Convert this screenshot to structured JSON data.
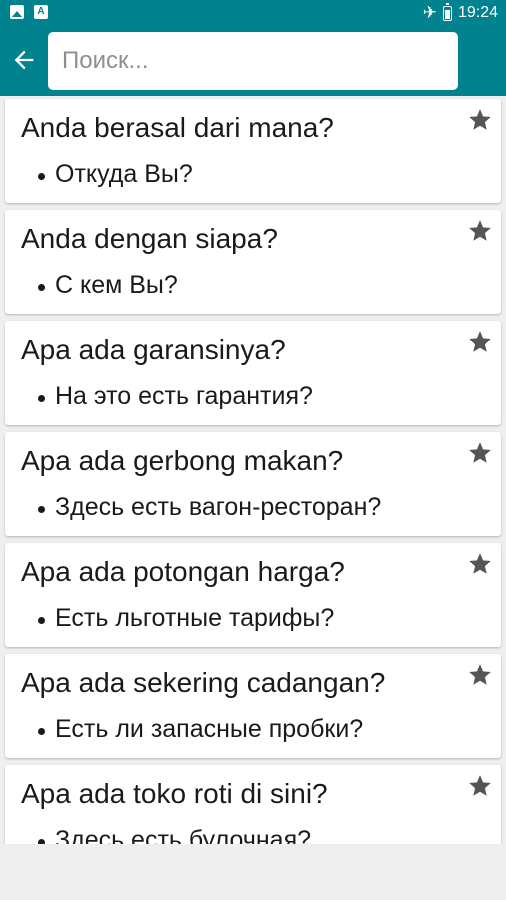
{
  "status_bar": {
    "time": "19:24"
  },
  "search": {
    "placeholder": "Поиск..."
  },
  "colors": {
    "accent": "#00838f",
    "background": "#efefef",
    "star": "#555555"
  },
  "phrases": [
    {
      "phrase": "Anda berasal dari mana?",
      "translation": "Откуда Вы?"
    },
    {
      "phrase": "Anda dengan siapa?",
      "translation": "С кем Вы?"
    },
    {
      "phrase": "Apa ada garansinya?",
      "translation": "На это есть гарантия?"
    },
    {
      "phrase": "Apa ada gerbong makan?",
      "translation": "Здесь есть вагон-ресторан?"
    },
    {
      "phrase": "Apa ada potongan harga?",
      "translation": "Есть льготные тарифы?"
    },
    {
      "phrase": "Apa ada sekering cadangan?",
      "translation": "Есть ли запасные пробки?"
    },
    {
      "phrase": "Apa ada toko roti di sini?",
      "translation": "Здесь есть булочная?"
    }
  ]
}
